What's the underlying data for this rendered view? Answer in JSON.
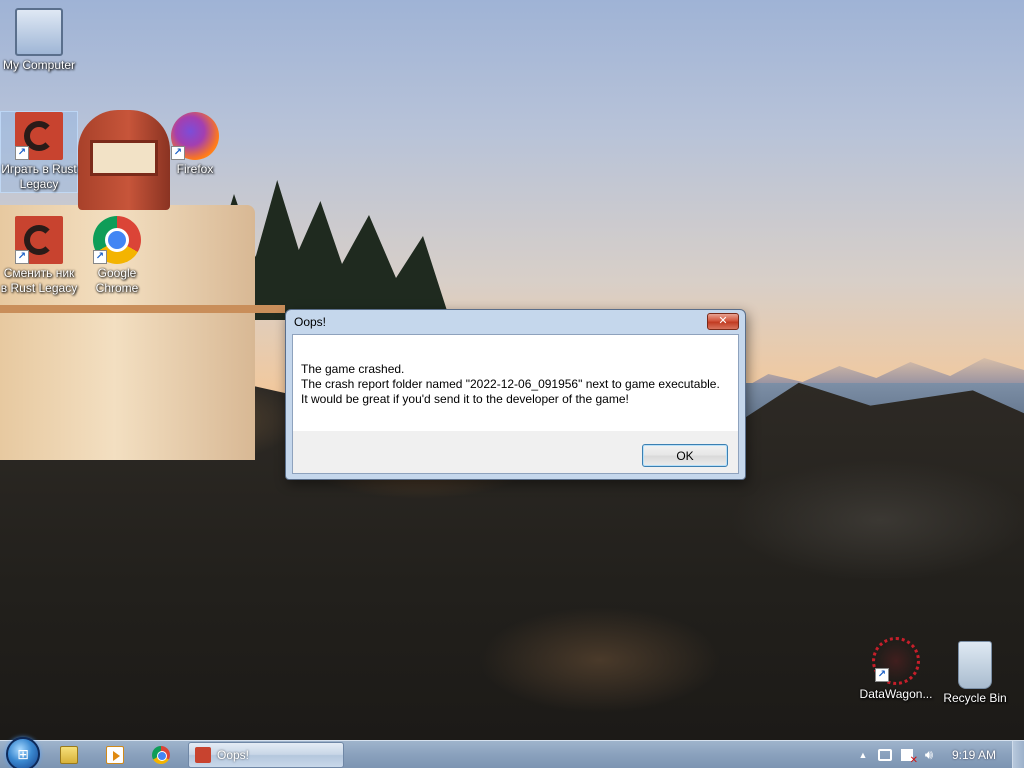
{
  "desktop": {
    "icons": [
      {
        "label": "My Computer",
        "icon": "computer-icon"
      },
      {
        "label": "Играть в Rust Legacy",
        "icon": "rust-icon"
      },
      {
        "label": "Firefox",
        "icon": "firefox-icon"
      },
      {
        "label": "Сменить ник в Rust Legacy",
        "icon": "rust-icon"
      },
      {
        "label": "Google Chrome",
        "icon": "chrome-icon"
      },
      {
        "label": "DataWagon...",
        "icon": "datawagon-icon"
      },
      {
        "label": "Recycle Bin",
        "icon": "recycle-bin-icon"
      }
    ]
  },
  "dialog": {
    "title": "Oops!",
    "close_label": "✕",
    "message_lines": [
      "The game crashed.",
      "The crash report folder named \"2022-12-06_091956\" next to game executable.",
      "It would be great if you'd send it to the developer of the game!"
    ],
    "ok_label": "OK"
  },
  "taskbar": {
    "pinned": [
      "explorer-icon",
      "media-player-icon",
      "chrome-icon"
    ],
    "active_task": {
      "label": "Oops!",
      "icon": "rust-icon"
    },
    "tray": {
      "icons": [
        "show-hidden-icons-arrow",
        "network-icon",
        "action-center-icon",
        "volume-icon"
      ],
      "clock": "9:19 AM"
    }
  },
  "colors": {
    "dialog_frame": "#c5d7ec",
    "close_button": "#c13b22",
    "taskbar": "#8aa1bd",
    "ok_button_border": "#3c7fb1"
  }
}
